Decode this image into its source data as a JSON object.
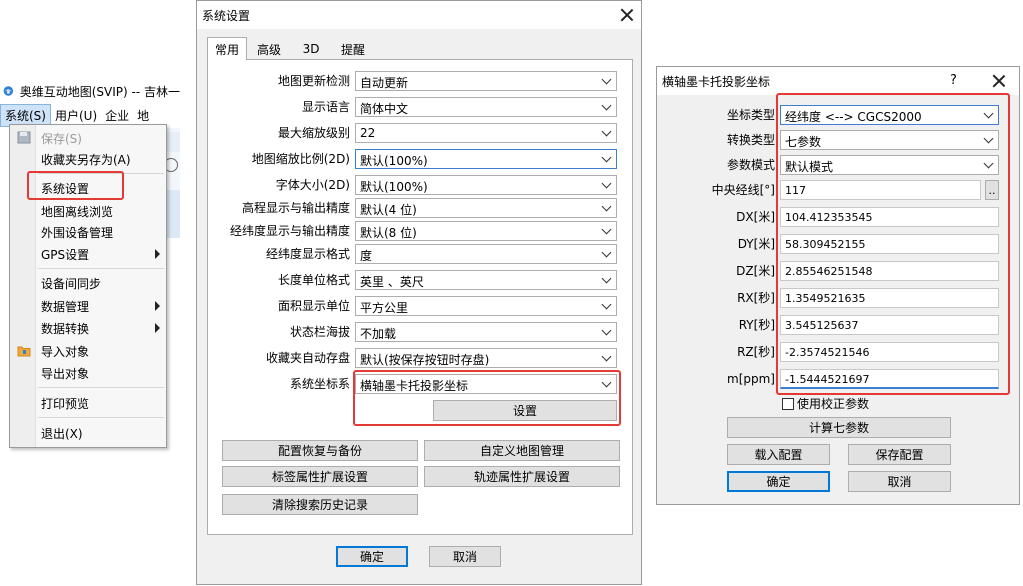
{
  "app": {
    "title": "奥维互动地图(SVIP) -- 吉林一",
    "menubar": [
      "系统(S)",
      "用户(U)",
      "企业",
      "地"
    ]
  },
  "system_menu": {
    "items": [
      {
        "label": "保存(S)",
        "disabled": true,
        "icon": "save-icon"
      },
      {
        "label": "收藏夹另存为(A)"
      },
      {
        "label": "系统设置"
      },
      {
        "label": "地图离线浏览"
      },
      {
        "label": "外围设备管理"
      },
      {
        "label": "GPS设置",
        "submenu": true
      },
      {
        "label": "设备间同步"
      },
      {
        "label": "数据管理",
        "submenu": true
      },
      {
        "label": "数据转换",
        "submenu": true
      },
      {
        "label": "导入对象",
        "icon": "folder-icon"
      },
      {
        "label": "导出对象"
      },
      {
        "label": "打印预览"
      },
      {
        "label": "退出(X)"
      }
    ]
  },
  "sys_dialog": {
    "title": "系统设置",
    "tabs": [
      "常用",
      "高级",
      "3D",
      "提醒"
    ],
    "fields": [
      {
        "label": "地图更新检测",
        "value": "自动更新"
      },
      {
        "label": "显示语言",
        "value": "简体中文"
      },
      {
        "label": "最大缩放级别",
        "value": "22"
      },
      {
        "label": "地图缩放比例(2D)",
        "value": "默认(100%)"
      },
      {
        "label": "字体大小(2D)",
        "value": "默认(100%)"
      },
      {
        "label": "高程显示与输出精度",
        "value": "默认(4 位)"
      },
      {
        "label": "经纬度显示与输出精度",
        "value": "默认(8 位)"
      },
      {
        "label": "经纬度显示格式",
        "value": "度"
      },
      {
        "label": "长度单位格式",
        "value": "英里 、英尺"
      },
      {
        "label": "面积显示单位",
        "value": "平方公里"
      },
      {
        "label": "状态栏海拔",
        "value": "不加载"
      },
      {
        "label": "收藏夹自动存盘",
        "value": "默认(按保存按钮时存盘)"
      },
      {
        "label": "系统坐标系",
        "value": "横轴墨卡托投影坐标"
      }
    ],
    "settings_button": "设置",
    "buttons": [
      "配置恢复与备份",
      "自定义地图管理",
      "标签属性扩展设置",
      "轨迹属性扩展设置",
      "清除搜索历史记录"
    ],
    "ok": "确定",
    "cancel": "取消"
  },
  "tm_dialog": {
    "title": "横轴墨卡托投影坐标",
    "help": "?",
    "coord_type": {
      "label": "坐标类型",
      "value": "经纬度 <--> CGCS2000"
    },
    "conv_type": {
      "label": "转换类型",
      "value": "七参数"
    },
    "param_mode": {
      "label": "参数模式",
      "value": "默认模式"
    },
    "central_meridian": {
      "label": "中央经线[°]",
      "value": "117",
      "browse": ".."
    },
    "params": [
      {
        "label": "DX[米]",
        "value": "104.412353545"
      },
      {
        "label": "DY[米]",
        "value": "58.309452155"
      },
      {
        "label": "DZ[米]",
        "value": "2.85546251548"
      },
      {
        "label": "RX[秒]",
        "value": "1.3549521635"
      },
      {
        "label": "RY[秒]",
        "value": "3.545125637"
      },
      {
        "label": "RZ[秒]",
        "value": "-2.3574521546"
      },
      {
        "label": "m[ppm]",
        "value": "-1.5444521697"
      }
    ],
    "use_correction": "使用校正参数",
    "calc_button": "计算七参数",
    "load_button": "载入配置",
    "save_button": "保存配置",
    "ok": "确定",
    "cancel": "取消"
  },
  "colors": {
    "highlight": "#e53935",
    "focus": "#0078d7",
    "dialog_bg": "#f0f0f0"
  }
}
